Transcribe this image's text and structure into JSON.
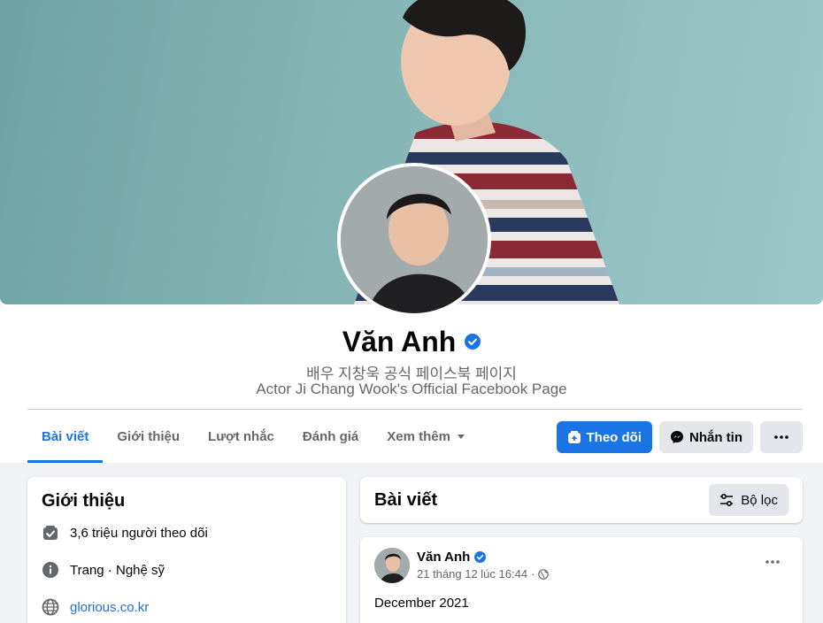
{
  "profile": {
    "name": "Văn Anh",
    "subtitle_korean": "배우 지창욱 공식 페이스북 페이지",
    "subtitle_english": "Actor Ji Chang Wook's Official Facebook Page"
  },
  "tabs": [
    {
      "label": "Bài viết",
      "active": true
    },
    {
      "label": "Giới thiệu"
    },
    {
      "label": "Lượt nhắc"
    },
    {
      "label": "Đánh giá"
    },
    {
      "label": "Xem thêm"
    }
  ],
  "actions": {
    "follow_label": "Theo dõi",
    "message_label": "Nhắn tin"
  },
  "intro": {
    "title": "Giới thiệu",
    "followers": "3,6 triệu người theo dõi",
    "page_type_prefix": "Trang",
    "page_type_sep": " · ",
    "page_type": "Nghệ sỹ",
    "website": "glorious.co.kr"
  },
  "posts": {
    "title": "Bài viết",
    "filter_label": "Bộ lọc"
  },
  "post": {
    "author": "Văn Anh",
    "timestamp": "21 tháng 12 lúc 16:44",
    "separator": "·",
    "text": "December 2021",
    "text2": "-"
  },
  "colors": {
    "accent": "#1b74e4",
    "link": "#216fdb",
    "cover": "#86b6b6"
  }
}
